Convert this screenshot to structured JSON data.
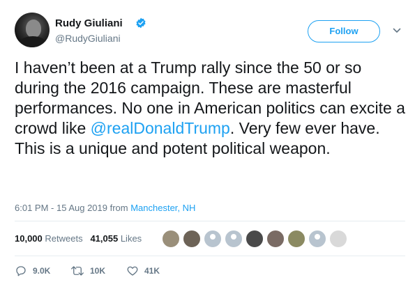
{
  "user": {
    "name": "Rudy Giuliani",
    "handle": "@RudyGiuliani",
    "follow_label": "Follow"
  },
  "tweet": {
    "text_part1": "I haven’t been at a Trump rally since the 50 or so during the 2016 campaign. These are masterful performances. No one in American politics can excite a crowd like ",
    "mention": "@realDonaldTrump",
    "text_part2": ". Very few ever have. This is a unique and potent political weapon."
  },
  "meta": {
    "time": "6:01 PM - 15 Aug 2019",
    "from_label": " from ",
    "location": "Manchester, NH"
  },
  "stats": {
    "retweets_count": "10,000",
    "retweets_label": "Retweets",
    "likes_count": "41,055",
    "likes_label": "Likes"
  },
  "actions": {
    "reply_count": "9.0K",
    "retweet_count": "10K",
    "like_count": "41K"
  },
  "colors": {
    "accent": "#1da1f2",
    "secondary_text": "#657786",
    "primary_text": "#14171a"
  }
}
